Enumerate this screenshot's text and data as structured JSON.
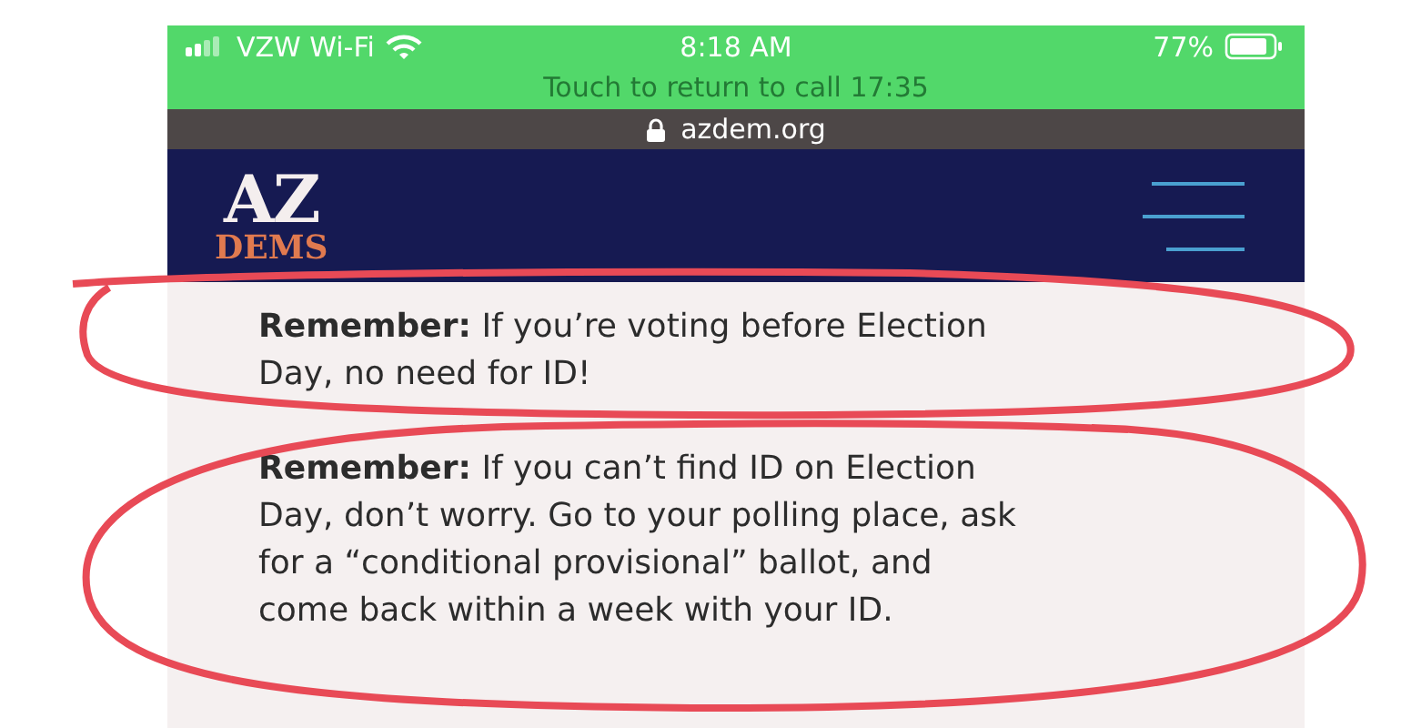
{
  "status_bar": {
    "carrier": "VZW Wi-Fi",
    "time": "8:18 AM",
    "battery": "77%"
  },
  "call_banner": "Touch to return to call 17:35",
  "address_bar": {
    "url": "azdem.org"
  },
  "header": {
    "logo_top": "AZ",
    "logo_bottom": "DEMS"
  },
  "paragraphs": [
    "**Remember:** If you’re voting before Election Day, no need for ID!",
    "**Remember:** If you can’t find ID on Election Day, don’t worry.  Go to your polling place, ask for a “conditional provisional” ballot, and come back within a week with your ID."
  ]
}
